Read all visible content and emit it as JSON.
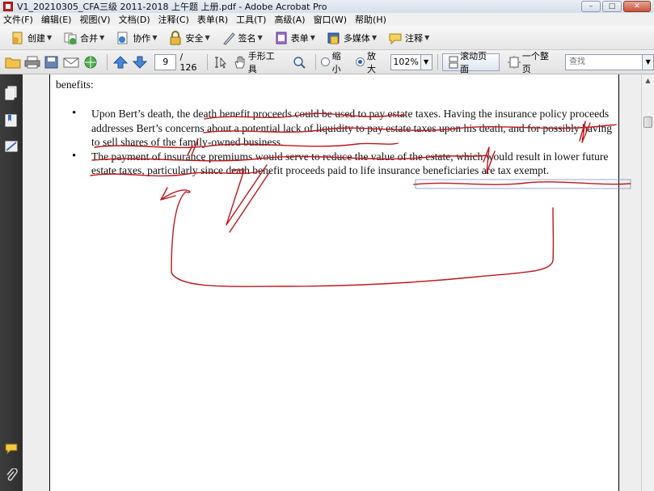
{
  "window": {
    "title": "V1_20210305_CFA三级 2011-2018 上午题  上册.pdf - Adobe Acrobat Pro",
    "buttons": {
      "minimize": "–",
      "maximize": "□",
      "close": "✕"
    }
  },
  "menu": [
    "文件(F)",
    "编辑(E)",
    "视图(V)",
    "文档(D)",
    "注释(C)",
    "表单(R)",
    "工具(T)",
    "高级(A)",
    "窗口(W)",
    "帮助(H)"
  ],
  "toolbar1": [
    {
      "label": "创建",
      "icon": "create-icon"
    },
    {
      "label": "合并",
      "icon": "combine-icon"
    },
    {
      "label": "协作",
      "icon": "collaborate-icon"
    },
    {
      "label": "安全",
      "icon": "lock-icon"
    },
    {
      "label": "签名",
      "icon": "pen-icon"
    },
    {
      "label": "表单",
      "icon": "form-icon"
    },
    {
      "label": "多媒体",
      "icon": "multimedia-icon"
    },
    {
      "label": "注释",
      "icon": "comment-icon"
    }
  ],
  "toolbar2": {
    "page_current": "9",
    "page_total": "/ 126",
    "hand_tool": "手形工具",
    "zoom_out": "缩小",
    "zoom_in": "放大",
    "zoom_value": "102%",
    "scroll_page": "滚动页面",
    "single_page": "一个整页",
    "search_placeholder": "查找"
  },
  "document": {
    "heading": "benefits:",
    "bullets": [
      "Upon Bert’s death, the death benefit proceeds could be used to pay estate taxes. Having the insurance policy proceeds addresses Bert’s concerns about a potential lack of liquidity to pay estate taxes upon his death, and for possibly having to sell shares of the family-owned business.",
      "The payment of insurance premiums would serve to reduce the value of the estate, which would result in lower future estate taxes, particularly since death benefit proceeds paid to life insurance beneficiaries are tax exempt."
    ]
  },
  "colors": {
    "ink": "#c0161b",
    "nav_pane": "#333333",
    "toolbar": "#e8e8e8"
  }
}
